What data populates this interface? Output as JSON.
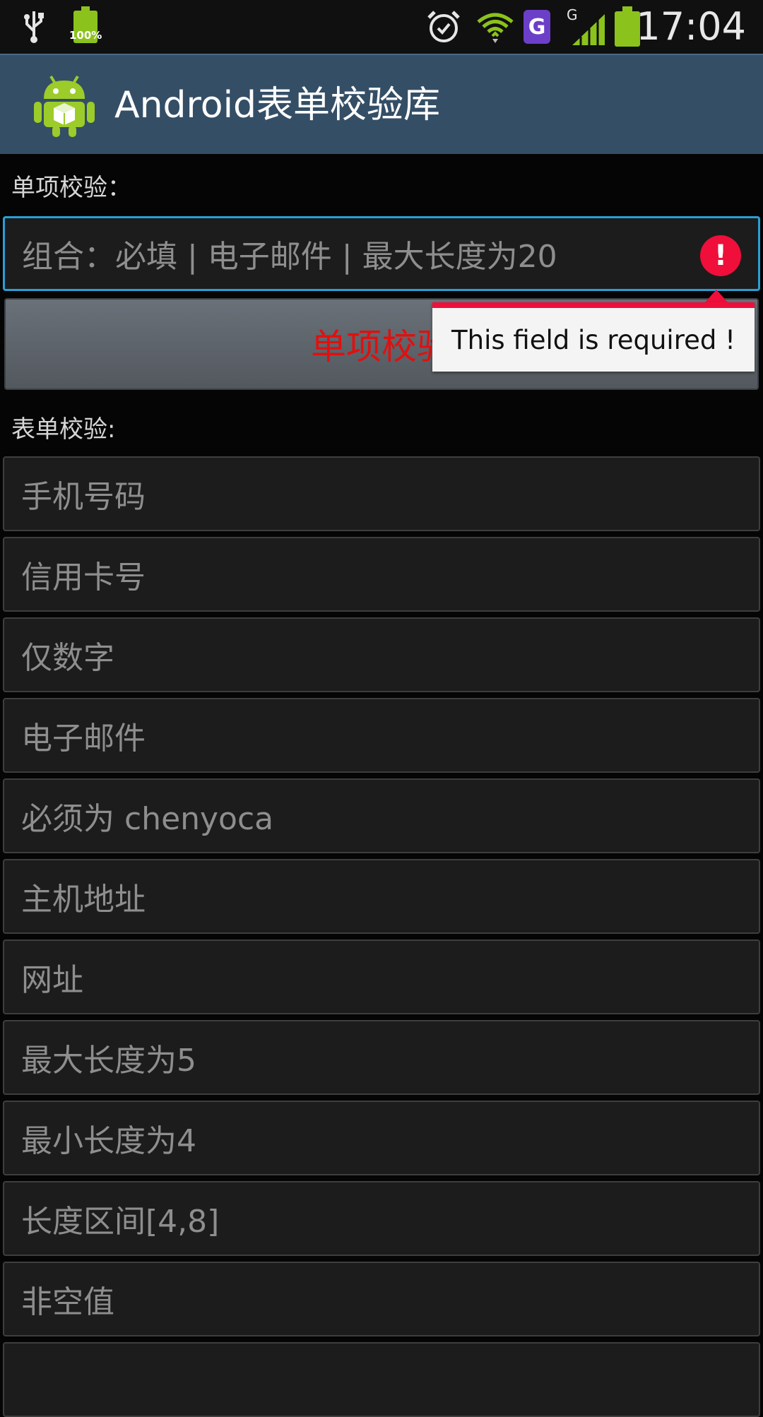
{
  "status_bar": {
    "battery_percent": "100%",
    "time": "17:04",
    "network_type": "G",
    "app_badge": "G"
  },
  "action_bar": {
    "title": "Android表单校验库"
  },
  "single": {
    "section_label": "单项校验：",
    "input_placeholder": "组合：必填 | 电子邮件 | 最大长度为20",
    "button_label": "单项校验",
    "error_message": "This field is required !"
  },
  "form": {
    "section_label": "表单校验:",
    "fields": [
      "手机号码",
      "信用卡号",
      "仅数字",
      "电子邮件",
      "必须为 chenyoca",
      "主机地址",
      "网址",
      "最大长度为5",
      "最小长度为4",
      "长度区间[4,8]",
      "非空值"
    ]
  },
  "colors": {
    "action_bar": "#344e66",
    "focus_border": "#2a9fd2",
    "error_red": "#ef0f3a",
    "button_text": "#e0100f"
  }
}
